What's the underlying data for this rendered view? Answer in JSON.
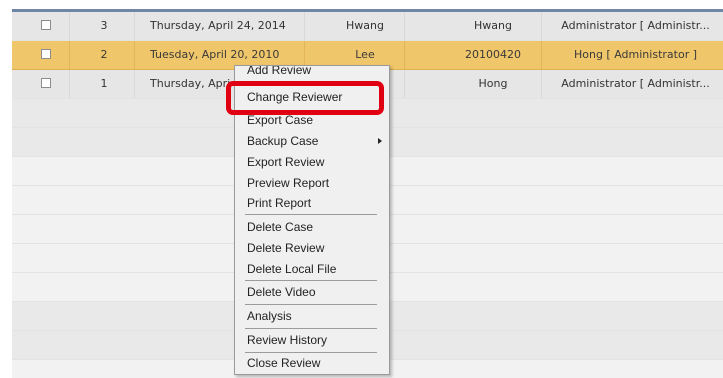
{
  "table": {
    "rows": [
      {
        "num": "3",
        "date": "Thursday, April 24, 2014",
        "name": "Hwang",
        "id": "Hwang",
        "reviewer": "Administrator [ Administr..."
      },
      {
        "num": "2",
        "date": "Tuesday, April 20, 2010",
        "name": "Lee",
        "id": "20100420",
        "reviewer": "Hong [ Administrator ]"
      },
      {
        "num": "1",
        "date": "Thursday, Apri",
        "name": "",
        "id": "Hong",
        "reviewer": "Administrator [ Administr..."
      }
    ]
  },
  "context_menu": {
    "items": [
      {
        "label": "Add Review",
        "has_submenu": false
      },
      {
        "label": "Change Reviewer",
        "has_submenu": false
      },
      {
        "label": "Export Case",
        "has_submenu": false
      },
      {
        "label": "Backup Case",
        "has_submenu": true
      },
      {
        "label": "Export Review",
        "has_submenu": false
      },
      {
        "label": "Preview Report",
        "has_submenu": false
      },
      {
        "label": "Print Report",
        "has_submenu": false
      },
      {
        "label": "Delete Case",
        "has_submenu": false
      },
      {
        "label": "Delete Review",
        "has_submenu": false
      },
      {
        "label": "Delete Local File",
        "has_submenu": false
      },
      {
        "label": "Delete Video",
        "has_submenu": false
      },
      {
        "label": "Analysis",
        "has_submenu": false
      },
      {
        "label": "Review History",
        "has_submenu": false
      },
      {
        "label": "Close Review",
        "has_submenu": false
      }
    ]
  },
  "colors": {
    "selected_row": "#f0c66a",
    "header_bar": "#6f86a8",
    "highlight": "#e10012"
  }
}
